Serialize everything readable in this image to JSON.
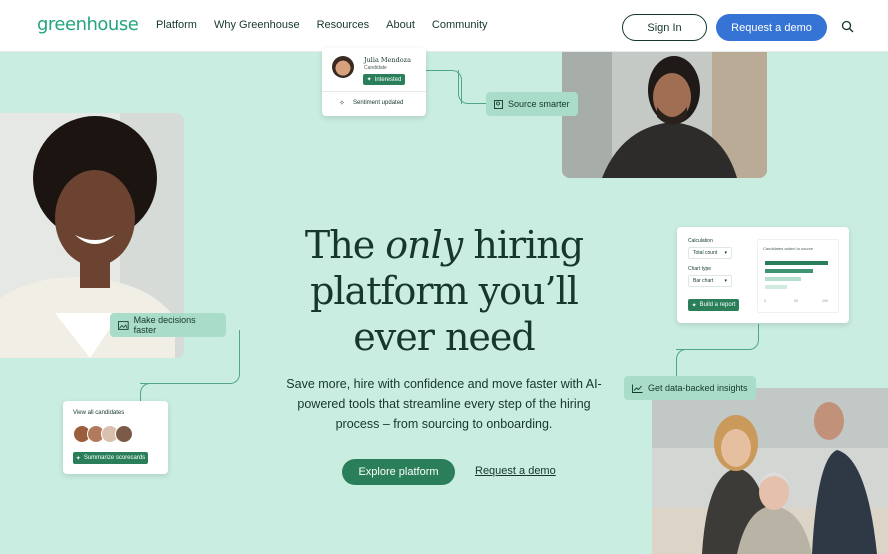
{
  "nav": {
    "logo": "greenhouse",
    "links": [
      "Platform",
      "Why Greenhouse",
      "Resources",
      "About",
      "Community"
    ],
    "signin_label": "Sign In",
    "demo_label": "Request a demo"
  },
  "hero": {
    "headline_pre": "The ",
    "headline_em": "only",
    "headline_line1_post": " hiring",
    "headline_line2": "platform you’ll",
    "headline_line3": "ever need",
    "subtext": "Save more, hire with confidence and move faster with AI-powered tools that streamline every step of the hiring process – from sourcing to onboarding.",
    "cta_primary": "Explore platform",
    "cta_secondary": "Request a demo"
  },
  "cards": {
    "candidate": {
      "name": "Julia Mendoza",
      "role": "Candidate",
      "tag": "Interested",
      "footer": "Sentiment updated"
    },
    "source_chip": "Source smarter",
    "decisions_chip": "Make decisions faster",
    "view_all": {
      "title": "View all candidates",
      "button": "Summarize scorecards"
    },
    "report": {
      "calc_label": "Calculation",
      "calc_value": "Total count",
      "chart_type_label": "Chart type",
      "chart_type_value": "Bar chart",
      "button": "Build a report",
      "preview_title": "Candidates added to source",
      "axis": [
        "0",
        "50",
        "100"
      ]
    },
    "insights_chip": "Get data-backed insights"
  },
  "colors": {
    "background": "#c9ede0",
    "brand_green": "#24a47f",
    "button_blue": "#3574d4",
    "button_green": "#2a7f5a"
  }
}
